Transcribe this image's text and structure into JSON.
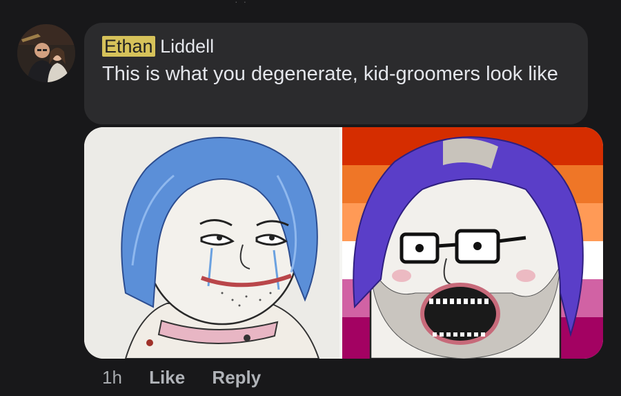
{
  "comment": {
    "author_first": "Ethan",
    "author_last": "Liddell",
    "text": "This is what you degenerate, kid-groomers look like"
  },
  "actions": {
    "time": "1h",
    "like_label": "Like",
    "reply_label": "Reply"
  },
  "colors": {
    "background": "#18181a",
    "bubble": "#2b2b2d",
    "text": "#e4e6eb",
    "highlight": "#d6c25a",
    "meta_text": "#a8abaf"
  },
  "icons": [
    "avatar-image",
    "meme-image"
  ]
}
